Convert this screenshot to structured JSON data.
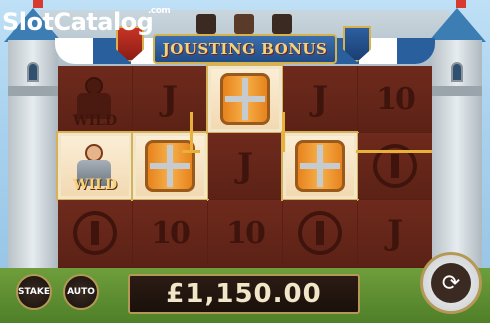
{
  "watermark": {
    "text": "SlotCatalog",
    "suffix": ".com"
  },
  "title": "JOUSTING BONUS",
  "reels": [
    [
      "knight-wild-dark",
      "knight-wild",
      "ornament"
    ],
    [
      "J",
      "shield",
      "10"
    ],
    [
      "shield",
      "J",
      "10"
    ],
    [
      "J",
      "shield",
      "ornament"
    ],
    [
      "10",
      "ornament",
      "J"
    ]
  ],
  "wild_label": "WILD",
  "controls": {
    "stake_label": "STAKE",
    "auto_label": "AUTO",
    "spin_icon": "refresh-arrows-icon"
  },
  "balance": "£1,150.00",
  "colors": {
    "reel_bg": "#5c2216",
    "win_highlight": "#f2d9b2",
    "payline": "#e8b23a",
    "gold_trim": "#b59855"
  }
}
